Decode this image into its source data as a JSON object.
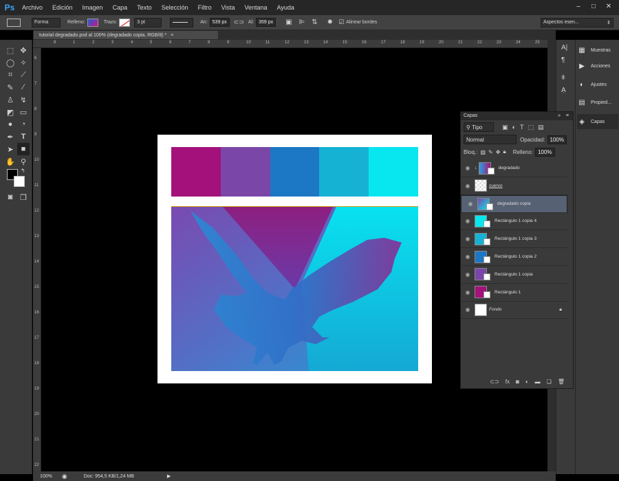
{
  "app": {
    "logo": "Ps"
  },
  "menu": [
    "Archivo",
    "Edición",
    "Imagen",
    "Capa",
    "Texto",
    "Selección",
    "Filtro",
    "Vista",
    "Ventana",
    "Ayuda"
  ],
  "window_controls": [
    "–",
    "□",
    "✕"
  ],
  "options": {
    "mode": "Forma",
    "fill_label": "Relleno:",
    "stroke_label": "Trazo:",
    "stroke_width": "3 pt",
    "width_label": "An:",
    "width": "539 px",
    "height_label": "Al:",
    "height": "359 px",
    "align_edges": "Alinear bordes",
    "workspace": "Aspectos esen..."
  },
  "document": {
    "tab": "tutorial degradado.psd al 100% (degradado copia, RGB/8) *",
    "zoom": "100%",
    "doc_info": "Doc: 954,5 KB/1,24 MB"
  },
  "ruler_h": [
    "8",
    "1",
    "2",
    "3",
    "4",
    "5",
    "6",
    "7",
    "8",
    "9",
    "10",
    "11",
    "12",
    "13",
    "14",
    "15",
    "16",
    "17",
    "18",
    "19",
    "20",
    "21",
    "22",
    "23",
    "24",
    "25"
  ],
  "ruler_v": [
    "6",
    "7",
    "8",
    "9",
    "10",
    "11",
    "12",
    "13",
    "14",
    "15",
    "16",
    "17",
    "18",
    "19",
    "20",
    "21",
    "22"
  ],
  "palette": [
    "#a4117a",
    "#7a47a8",
    "#1c77c4",
    "#15b2d4",
    "#08e6ef"
  ],
  "dock": [
    "Muestras",
    "Acciones",
    "Ajustes",
    "Propied...",
    "Capas"
  ],
  "layers_panel": {
    "title": "Capas",
    "filter": "Tipo",
    "blend": "Normal",
    "opacity_label": "Opacidad:",
    "opacity": "100%",
    "lock_label": "Bloq.:",
    "fill_label": "Relleno:",
    "fill": "100%",
    "layers": [
      {
        "name": "degradado",
        "thumb": "linear-gradient(90deg,#2aa0e0,#a4117a)"
      },
      {
        "name": "cuervo",
        "thumb": "#ffffff"
      },
      {
        "name": "degradado copia",
        "thumb": "linear-gradient(135deg,#7a47a8,#08e6ef)"
      },
      {
        "name": "Rectángulo 1 copia 4",
        "thumb": "#08e6ef"
      },
      {
        "name": "Rectángulo 1 copia 3",
        "thumb": "#15b2d4"
      },
      {
        "name": "Rectángulo 1 copia 2",
        "thumb": "#1c77c4"
      },
      {
        "name": "Rectángulo 1 copia",
        "thumb": "#7a47a8"
      },
      {
        "name": "Rectángulo 1",
        "thumb": "#a4117a"
      },
      {
        "name": "Fondo",
        "thumb": "#ffffff"
      }
    ]
  }
}
